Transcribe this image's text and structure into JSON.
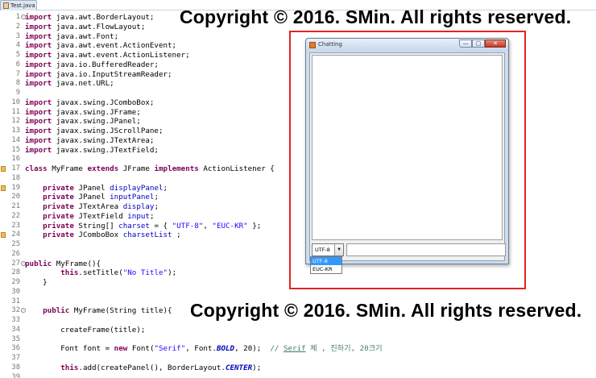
{
  "editor": {
    "tab_label": "Test.java",
    "lines": [
      {
        "n": "1",
        "parts": [
          [
            "kw",
            "import"
          ],
          [
            "t",
            " java.awt.BorderLayout;"
          ]
        ],
        "fold": "-"
      },
      {
        "n": "2",
        "parts": [
          [
            "kw",
            "import"
          ],
          [
            "t",
            " java.awt.FlowLayout;"
          ]
        ]
      },
      {
        "n": "3",
        "parts": [
          [
            "kw",
            "import"
          ],
          [
            "t",
            " java.awt.Font;"
          ]
        ]
      },
      {
        "n": "4",
        "parts": [
          [
            "kw",
            "import"
          ],
          [
            "t",
            " java.awt.event.ActionEvent;"
          ]
        ]
      },
      {
        "n": "5",
        "parts": [
          [
            "kw",
            "import"
          ],
          [
            "t",
            " java.awt.event.ActionListener;"
          ]
        ]
      },
      {
        "n": "6",
        "parts": [
          [
            "kw",
            "import"
          ],
          [
            "t",
            " java.io.BufferedReader;"
          ]
        ]
      },
      {
        "n": "7",
        "parts": [
          [
            "kw",
            "import"
          ],
          [
            "t",
            " java.io.InputStreamReader;"
          ]
        ]
      },
      {
        "n": "8",
        "parts": [
          [
            "kw",
            "import"
          ],
          [
            "t",
            " java.net.URL;"
          ]
        ]
      },
      {
        "n": "9",
        "parts": []
      },
      {
        "n": "10",
        "parts": [
          [
            "kw",
            "import"
          ],
          [
            "t",
            " javax.swing.JComboBox;"
          ]
        ]
      },
      {
        "n": "11",
        "parts": [
          [
            "kw",
            "import"
          ],
          [
            "t",
            " javax.swing.JFrame;"
          ]
        ]
      },
      {
        "n": "12",
        "parts": [
          [
            "kw",
            "import"
          ],
          [
            "t",
            " javax.swing.JPanel;"
          ]
        ]
      },
      {
        "n": "13",
        "parts": [
          [
            "kw",
            "import"
          ],
          [
            "t",
            " javax.swing.JScrollPane;"
          ]
        ]
      },
      {
        "n": "14",
        "parts": [
          [
            "kw",
            "import"
          ],
          [
            "t",
            " javax.swing.JTextArea;"
          ]
        ]
      },
      {
        "n": "15",
        "parts": [
          [
            "kw",
            "import"
          ],
          [
            "t",
            " javax.swing.JTextField;"
          ]
        ]
      },
      {
        "n": "16",
        "parts": []
      },
      {
        "n": "17",
        "parts": [
          [
            "kw",
            "class"
          ],
          [
            "t",
            " MyFrame "
          ],
          [
            "kw",
            "extends"
          ],
          [
            "t",
            " JFrame "
          ],
          [
            "kw",
            "implements"
          ],
          [
            "t",
            " ActionListener {"
          ]
        ],
        "marker": true
      },
      {
        "n": "18",
        "parts": []
      },
      {
        "n": "19",
        "parts": [
          [
            "t",
            "    "
          ],
          [
            "kw",
            "private"
          ],
          [
            "t",
            " JPanel "
          ],
          [
            "fld",
            "displayPanel"
          ],
          [
            "t",
            ";"
          ]
        ],
        "marker": true
      },
      {
        "n": "20",
        "parts": [
          [
            "t",
            "    "
          ],
          [
            "kw",
            "private"
          ],
          [
            "t",
            " JPanel "
          ],
          [
            "fld",
            "inputPanel"
          ],
          [
            "t",
            ";"
          ]
        ]
      },
      {
        "n": "21",
        "parts": [
          [
            "t",
            "    "
          ],
          [
            "kw",
            "private"
          ],
          [
            "t",
            " JTextArea "
          ],
          [
            "fld",
            "display"
          ],
          [
            "t",
            ";"
          ]
        ]
      },
      {
        "n": "22",
        "parts": [
          [
            "t",
            "    "
          ],
          [
            "kw",
            "private"
          ],
          [
            "t",
            " JTextField "
          ],
          [
            "fld",
            "input"
          ],
          [
            "t",
            ";"
          ]
        ]
      },
      {
        "n": "23",
        "parts": [
          [
            "t",
            "    "
          ],
          [
            "kw",
            "private"
          ],
          [
            "t",
            " String[] "
          ],
          [
            "fld",
            "charset"
          ],
          [
            "t",
            " = { "
          ],
          [
            "str",
            "\"UTF-8\""
          ],
          [
            "t",
            ", "
          ],
          [
            "str",
            "\"EUC-KR\""
          ],
          [
            "t",
            " };"
          ]
        ]
      },
      {
        "n": "24",
        "parts": [
          [
            "t",
            "    "
          ],
          [
            "kw",
            "private"
          ],
          [
            "t",
            " JComboBox "
          ],
          [
            "fld",
            "charsetList"
          ],
          [
            "t",
            " ;"
          ]
        ],
        "marker": true
      },
      {
        "n": "25",
        "parts": []
      },
      {
        "n": "26",
        "parts": []
      },
      {
        "n": "27",
        "parts": [
          [
            "kw",
            "public"
          ],
          [
            "t",
            " MyFrame(){"
          ]
        ],
        "fold": "-"
      },
      {
        "n": "28",
        "parts": [
          [
            "t",
            "        "
          ],
          [
            "kw",
            "this"
          ],
          [
            "t",
            ".setTitle("
          ],
          [
            "str",
            "\"No Title\""
          ],
          [
            "t",
            ");"
          ]
        ]
      },
      {
        "n": "29",
        "parts": [
          [
            "t",
            "    }"
          ]
        ]
      },
      {
        "n": "30",
        "parts": []
      },
      {
        "n": "31",
        "parts": []
      },
      {
        "n": "32",
        "parts": [
          [
            "t",
            "    "
          ],
          [
            "kw",
            "public"
          ],
          [
            "t",
            " MyFrame(String title){"
          ]
        ],
        "fold": "-"
      },
      {
        "n": "33",
        "parts": []
      },
      {
        "n": "34",
        "parts": [
          [
            "t",
            "        createFrame(title);"
          ]
        ]
      },
      {
        "n": "35",
        "parts": []
      },
      {
        "n": "36",
        "parts": [
          [
            "t",
            "        Font "
          ],
          [
            "t",
            "font"
          ],
          [
            "t",
            " = "
          ],
          [
            "kw",
            "new"
          ],
          [
            "t",
            " Font("
          ],
          [
            "str",
            "\"Serif\""
          ],
          [
            "t",
            ", Font."
          ],
          [
            "cst",
            "BOLD"
          ],
          [
            "t",
            ", 20);  "
          ],
          [
            "cmt",
            "// "
          ],
          [
            "cmtu",
            "Serif"
          ],
          [
            "cmt",
            " 체 , 진하기, 20크기"
          ]
        ]
      },
      {
        "n": "37",
        "parts": []
      },
      {
        "n": "38",
        "parts": [
          [
            "t",
            "        "
          ],
          [
            "kw",
            "this"
          ],
          [
            "t",
            ".add(createPanel(), BorderLayout."
          ],
          [
            "cst",
            "CENTER"
          ],
          [
            "t",
            ");"
          ]
        ]
      },
      {
        "n": "39",
        "parts": []
      }
    ]
  },
  "watermark": {
    "top": "Copyright © 2016. SMin. All rights reserved.",
    "bottom": "Copyright © 2016. SMin. All rights reserved."
  },
  "chat_window": {
    "title": "Chatting",
    "min_glyph": "—",
    "max_glyph": "▢",
    "close_glyph": "✕",
    "charset_selected": "UTF-8",
    "charset_arrow": "▼",
    "charset_options": [
      "UTF-8",
      "EUC-KR"
    ]
  },
  "colors": {
    "keyword": "#7f0055",
    "field": "#0000c0",
    "string": "#2a00ff",
    "comment": "#3f7f5f",
    "highlight_box": "#e32424"
  }
}
